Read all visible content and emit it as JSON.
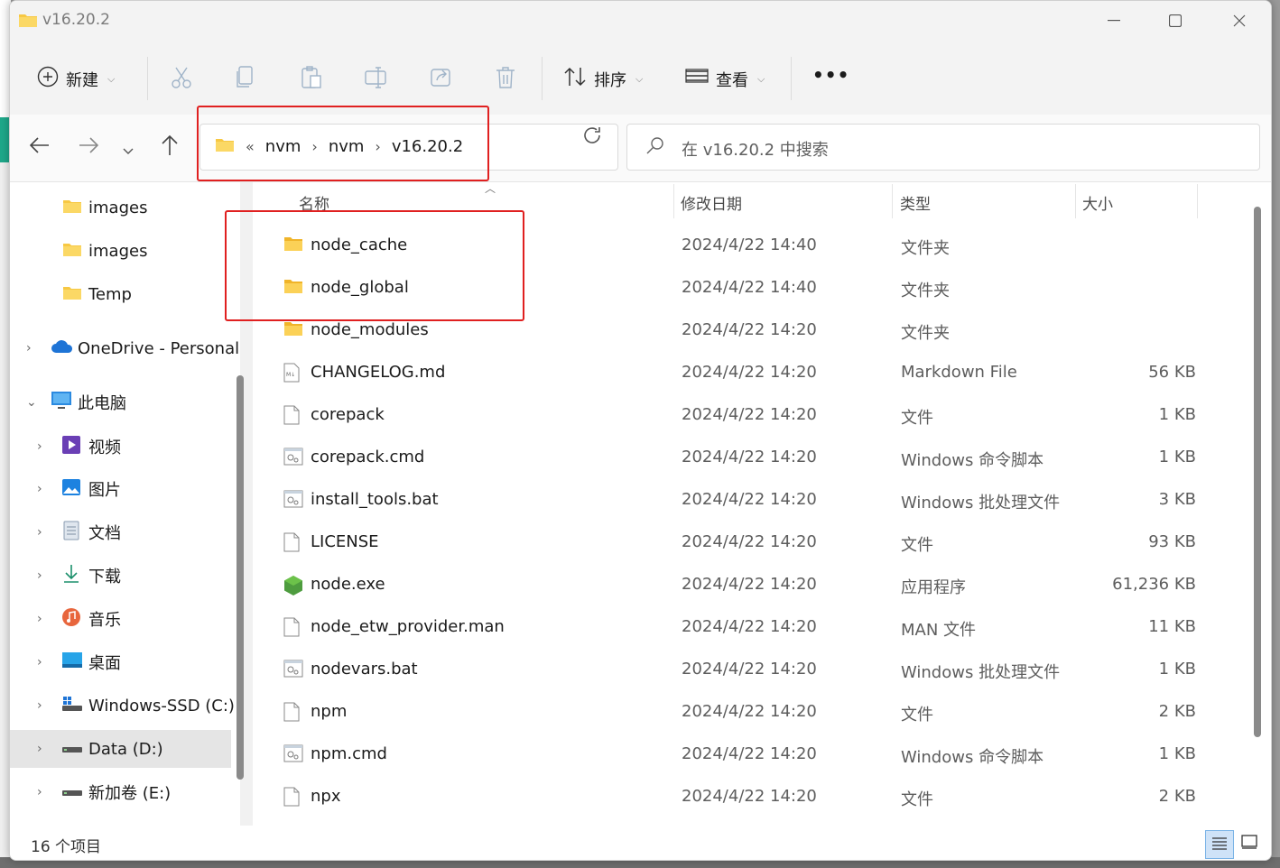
{
  "window": {
    "title": "v16.20.2"
  },
  "toolbar": {
    "new_label": "新建",
    "sort_label": "排序",
    "view_label": "查看",
    "more_label": "•••"
  },
  "address": {
    "overflow": "«",
    "crumbs": [
      "nvm",
      "nvm",
      "v16.20.2"
    ]
  },
  "search": {
    "placeholder": "在 v16.20.2 中搜索"
  },
  "sidebar": {
    "items": [
      {
        "label": "images",
        "icon": "folder-icon"
      },
      {
        "label": "images",
        "icon": "folder-icon"
      },
      {
        "label": "Temp",
        "icon": "folder-icon"
      },
      {
        "label": "OneDrive - Personal",
        "icon": "onedrive-icon"
      },
      {
        "label": "此电脑",
        "icon": "pc-icon"
      },
      {
        "label": "视频",
        "icon": "video-icon"
      },
      {
        "label": "图片",
        "icon": "pictures-icon"
      },
      {
        "label": "文档",
        "icon": "documents-icon"
      },
      {
        "label": "下载",
        "icon": "download-icon"
      },
      {
        "label": "音乐",
        "icon": "music-icon"
      },
      {
        "label": "桌面",
        "icon": "desktop-icon"
      },
      {
        "label": "Windows-SSD (C:)",
        "icon": "drive-c-icon"
      },
      {
        "label": "Data (D:)",
        "icon": "drive-icon"
      },
      {
        "label": "新加卷 (E:)",
        "icon": "drive-icon"
      }
    ]
  },
  "columns": {
    "name": "名称",
    "date": "修改日期",
    "type": "类型",
    "size": "大小"
  },
  "files": [
    {
      "name": "node_cache",
      "date": "2024/4/22 14:40",
      "type": "文件夹",
      "size": "",
      "icon": "folder"
    },
    {
      "name": "node_global",
      "date": "2024/4/22 14:40",
      "type": "文件夹",
      "size": "",
      "icon": "folder"
    },
    {
      "name": "node_modules",
      "date": "2024/4/22 14:20",
      "type": "文件夹",
      "size": "",
      "icon": "folder"
    },
    {
      "name": "CHANGELOG.md",
      "date": "2024/4/22 14:20",
      "type": "Markdown File",
      "size": "56 KB",
      "icon": "md"
    },
    {
      "name": "corepack",
      "date": "2024/4/22 14:20",
      "type": "文件",
      "size": "1 KB",
      "icon": "file"
    },
    {
      "name": "corepack.cmd",
      "date": "2024/4/22 14:20",
      "type": "Windows 命令脚本",
      "size": "1 KB",
      "icon": "script"
    },
    {
      "name": "install_tools.bat",
      "date": "2024/4/22 14:20",
      "type": "Windows 批处理文件",
      "size": "3 KB",
      "icon": "script"
    },
    {
      "name": "LICENSE",
      "date": "2024/4/22 14:20",
      "type": "文件",
      "size": "93 KB",
      "icon": "file"
    },
    {
      "name": "node.exe",
      "date": "2024/4/22 14:20",
      "type": "应用程序",
      "size": "61,236 KB",
      "icon": "node"
    },
    {
      "name": "node_etw_provider.man",
      "date": "2024/4/22 14:20",
      "type": "MAN 文件",
      "size": "11 KB",
      "icon": "file"
    },
    {
      "name": "nodevars.bat",
      "date": "2024/4/22 14:20",
      "type": "Windows 批处理文件",
      "size": "1 KB",
      "icon": "script"
    },
    {
      "name": "npm",
      "date": "2024/4/22 14:20",
      "type": "文件",
      "size": "2 KB",
      "icon": "file"
    },
    {
      "name": "npm.cmd",
      "date": "2024/4/22 14:20",
      "type": "Windows 命令脚本",
      "size": "1 KB",
      "icon": "script"
    },
    {
      "name": "npx",
      "date": "2024/4/22 14:20",
      "type": "文件",
      "size": "2 KB",
      "icon": "file"
    }
  ],
  "status": {
    "count": "16 个项目"
  },
  "colors": {
    "highlight": "#e02020",
    "selected": "#e5e5e5",
    "folder": "#f7c843"
  }
}
